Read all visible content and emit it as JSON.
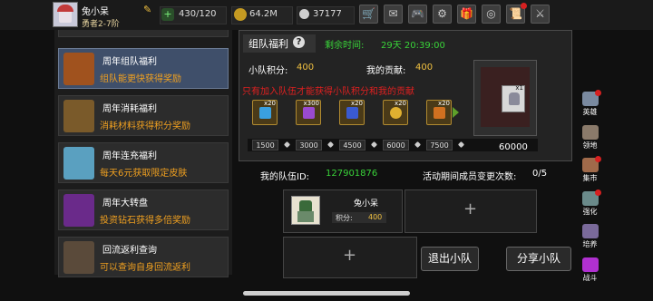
{
  "topbar": {
    "player_name": "兔小呆",
    "player_rank": "勇者2-7阶",
    "edit_icon": "pencil-icon",
    "energy": "430/120",
    "gold": "64.2M",
    "gems": "37177",
    "buttons": [
      {
        "icon": "shop-icon",
        "glyph": "🛒",
        "badge": false
      },
      {
        "icon": "mail-icon",
        "glyph": "✉",
        "badge": false
      },
      {
        "icon": "gamepad-icon",
        "glyph": "🎮",
        "badge": false
      },
      {
        "icon": "settings-gear-icon",
        "glyph": "⚙",
        "badge": false
      },
      {
        "icon": "gift-icon",
        "glyph": "🎁",
        "badge": false
      },
      {
        "icon": "rainbow-wheel-icon",
        "glyph": "◎",
        "badge": false
      },
      {
        "icon": "scroll-event-icon",
        "glyph": "📜",
        "badge": true
      },
      {
        "icon": "swords-icon",
        "glyph": "⚔",
        "badge": false
      }
    ]
  },
  "welfare_list": [
    {
      "title": "周年组队福利",
      "desc": "组队能更快获得奖励",
      "icon": "treasure-chest-icon",
      "active": true
    },
    {
      "title": "周年消耗福利",
      "desc": "消耗材料获得积分奖励",
      "icon": "open-chest-icon",
      "active": false
    },
    {
      "title": "周年连充福利",
      "desc": "每天6元获取限定皮肤",
      "icon": "crystal-icon",
      "active": false
    },
    {
      "title": "周年大转盘",
      "desc": "投资钻石获得多倍奖励",
      "icon": "wheel-icon",
      "active": false
    },
    {
      "title": "回流返利查询",
      "desc": "可以查询自身回流返利",
      "icon": "crate-icon",
      "active": false
    }
  ],
  "team_welfare": {
    "title": "组队福利",
    "remaining_label": "剩余时间:",
    "remaining_time": "29天 20:39:00",
    "team_points_label": "小队积分:",
    "team_points": "400",
    "my_contribution_label": "我的贡献:",
    "my_contribution": "400",
    "warning": "只有加入队伍才能获得小队积分和我的贡献",
    "rewards": [
      {
        "icon": "lightning-gem-icon",
        "count": "x20",
        "color": "#3aa0e0"
      },
      {
        "icon": "purple-shard-icon",
        "count": "x300",
        "color": "#9a4ad0"
      },
      {
        "icon": "blue-rune-icon",
        "count": "x20",
        "color": "#3a5ad0"
      },
      {
        "icon": "golden-egg-icon",
        "count": "x20",
        "color": "#e0b030"
      },
      {
        "icon": "orange-scroll-icon",
        "count": "x20",
        "color": "#d07020"
      }
    ],
    "milestones": [
      "1500",
      "3000",
      "4500",
      "6000",
      "7500"
    ],
    "final_milestone": "60000",
    "final_reward_count": "x1"
  },
  "team": {
    "id_label": "我的队伍ID:",
    "id": "127901876",
    "change_label": "活动期间成员变更次数:",
    "change_count": "0/5",
    "member": {
      "name": "兔小呆",
      "points_label": "积分:",
      "points": "400"
    },
    "plus": "+",
    "leave_label": "退出小队",
    "share_label": "分享小队"
  },
  "side_nav": [
    {
      "label": "英雄",
      "icon": "knight-helmet-icon",
      "color": "#7a8aa0",
      "badge": true
    },
    {
      "label": "领地",
      "icon": "castle-icon",
      "color": "#8a7a6a",
      "badge": false
    },
    {
      "label": "集市",
      "icon": "market-icon",
      "color": "#a06a4a",
      "badge": true
    },
    {
      "label": "强化",
      "icon": "anvil-icon",
      "color": "#6a8a8a",
      "badge": true
    },
    {
      "label": "培养",
      "icon": "flask-icon",
      "color": "#7a6a9a",
      "badge": false
    },
    {
      "label": "战斗",
      "icon": "portal-icon",
      "color": "#b030d0",
      "badge": false
    }
  ],
  "colors": {
    "accent_green": "#39d239",
    "accent_gold": "#f0c040",
    "warn_red": "#e02020",
    "desc_orange": "#f0a020"
  }
}
